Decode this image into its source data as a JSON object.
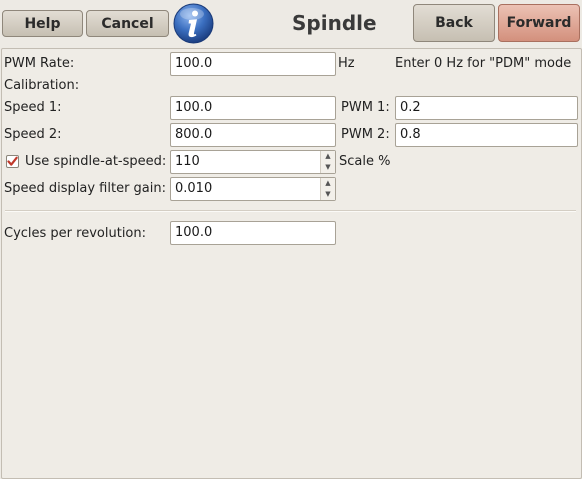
{
  "toolbar": {
    "help_label": "Help",
    "cancel_label": "Cancel",
    "info_icon": "info-icon",
    "title": "Spindle",
    "back_label": "Back",
    "forward_label": "Forward"
  },
  "pwm": {
    "label": "PWM Rate:",
    "value": "100.0",
    "unit": "Hz",
    "hint": "Enter 0 Hz for \"PDM\" mode"
  },
  "calibration": {
    "heading": "Calibration:",
    "speed1_label": "Speed 1:",
    "speed1_value": "100.0",
    "pwm1_label": "PWM 1:",
    "pwm1_value": "0.2",
    "speed2_label": "Speed 2:",
    "speed2_value": "800.0",
    "pwm2_label": "PWM 2:",
    "pwm2_value": "0.8"
  },
  "spindle_at_speed": {
    "label": "Use spindle-at-speed:",
    "checked": true,
    "value": "110",
    "unit": "Scale %"
  },
  "filter": {
    "label": "Speed display filter gain:",
    "value": "0.010"
  },
  "cycles": {
    "label": "Cycles per revolution:",
    "value": "100.0"
  },
  "colors": {
    "accent_button": "#d3907d",
    "checkbox_mark": "#c0392b",
    "info_icon_blue": "#2f5fa8"
  }
}
